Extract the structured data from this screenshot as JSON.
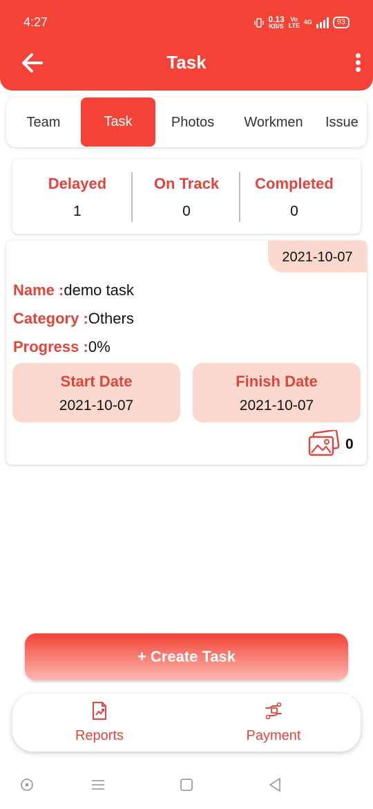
{
  "status_bar": {
    "time": "4:27",
    "net_speed": "0.13",
    "net_unit": "KB/S",
    "net_type": "Vo LTE",
    "signal": "4G",
    "battery": "93"
  },
  "header": {
    "title": "Task",
    "back_icon": "arrow-left-icon",
    "menu_icon": "more-vertical-icon"
  },
  "tabs": [
    {
      "label": "Team"
    },
    {
      "label": "Task",
      "active": true
    },
    {
      "label": "Photos"
    },
    {
      "label": "Workmen"
    },
    {
      "label": "Issue"
    }
  ],
  "summary": [
    {
      "label": "Delayed",
      "value": "1"
    },
    {
      "label": "On Track",
      "value": "0"
    },
    {
      "label": "Completed",
      "value": "0"
    }
  ],
  "task": {
    "date": "2021-10-07",
    "name_label": "Name :",
    "name": "demo task",
    "category_label": "Category :",
    "category": "Others",
    "progress_label": "Progress :",
    "progress": "0%",
    "start_label": "Start Date",
    "start_date": "2021-10-07",
    "finish_label": "Finish Date",
    "finish_date": "2021-10-07",
    "photo_count": "0"
  },
  "create_button": {
    "label": "+ Create Task"
  },
  "bottom_nav": [
    {
      "label": "Reports",
      "icon": "report-icon"
    },
    {
      "label": "Payment",
      "icon": "payment-icon"
    }
  ],
  "colors": {
    "primary": "#f44336",
    "accent_text": "#e0443a",
    "soft": "#fbd9cf"
  }
}
